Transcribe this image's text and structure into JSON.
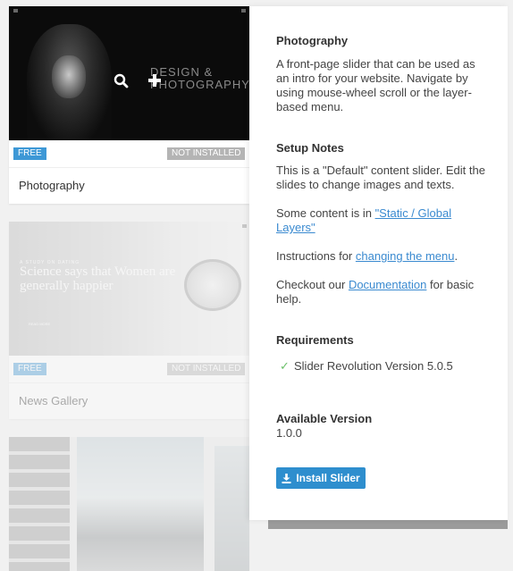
{
  "cards": [
    {
      "title": "Photography",
      "badge_free": "FREE",
      "badge_status": "NOT INSTALLED",
      "thumb_heading_line1": "DESIGN &",
      "thumb_heading_line2": "PHOTOGRAPHY"
    },
    {
      "title": "News Gallery",
      "badge_free": "FREE",
      "badge_status": "NOT INSTALLED",
      "thumb_small": "A STUDY ON DATING",
      "thumb_heading": "Science says that Women are generally happier",
      "thumb_button": "READ MORE"
    }
  ],
  "overlay_icons": {
    "search": "search-icon",
    "add": "plus-icon"
  },
  "panel": {
    "title": "Photography",
    "description": "A front-page slider that can be used as an intro for your website. Navigate by using mouse-wheel scroll or the layer-based menu.",
    "setup_heading": "Setup Notes",
    "setup_text": "This is a \"Default\" content slider. Edit the slides to change images and texts.",
    "some_content_prefix": "Some content is in ",
    "some_content_link": "\"Static / Global Layers\"",
    "instructions_prefix": "Instructions for ",
    "instructions_link": "changing the menu",
    "instructions_suffix": ".",
    "checkout_prefix": "Checkout our ",
    "checkout_link": "Documentation",
    "checkout_suffix": " for basic help.",
    "requirements_heading": "Requirements",
    "requirement_item": "Slider Revolution Version 5.0.5",
    "version_heading": "Available Version",
    "version_value": "1.0.0",
    "install_label": "Install Slider"
  },
  "colors": {
    "accent": "#2e8ece",
    "badge_free": "#3d98d6",
    "badge_status": "#b4b4b4",
    "check": "#6cc06a"
  }
}
